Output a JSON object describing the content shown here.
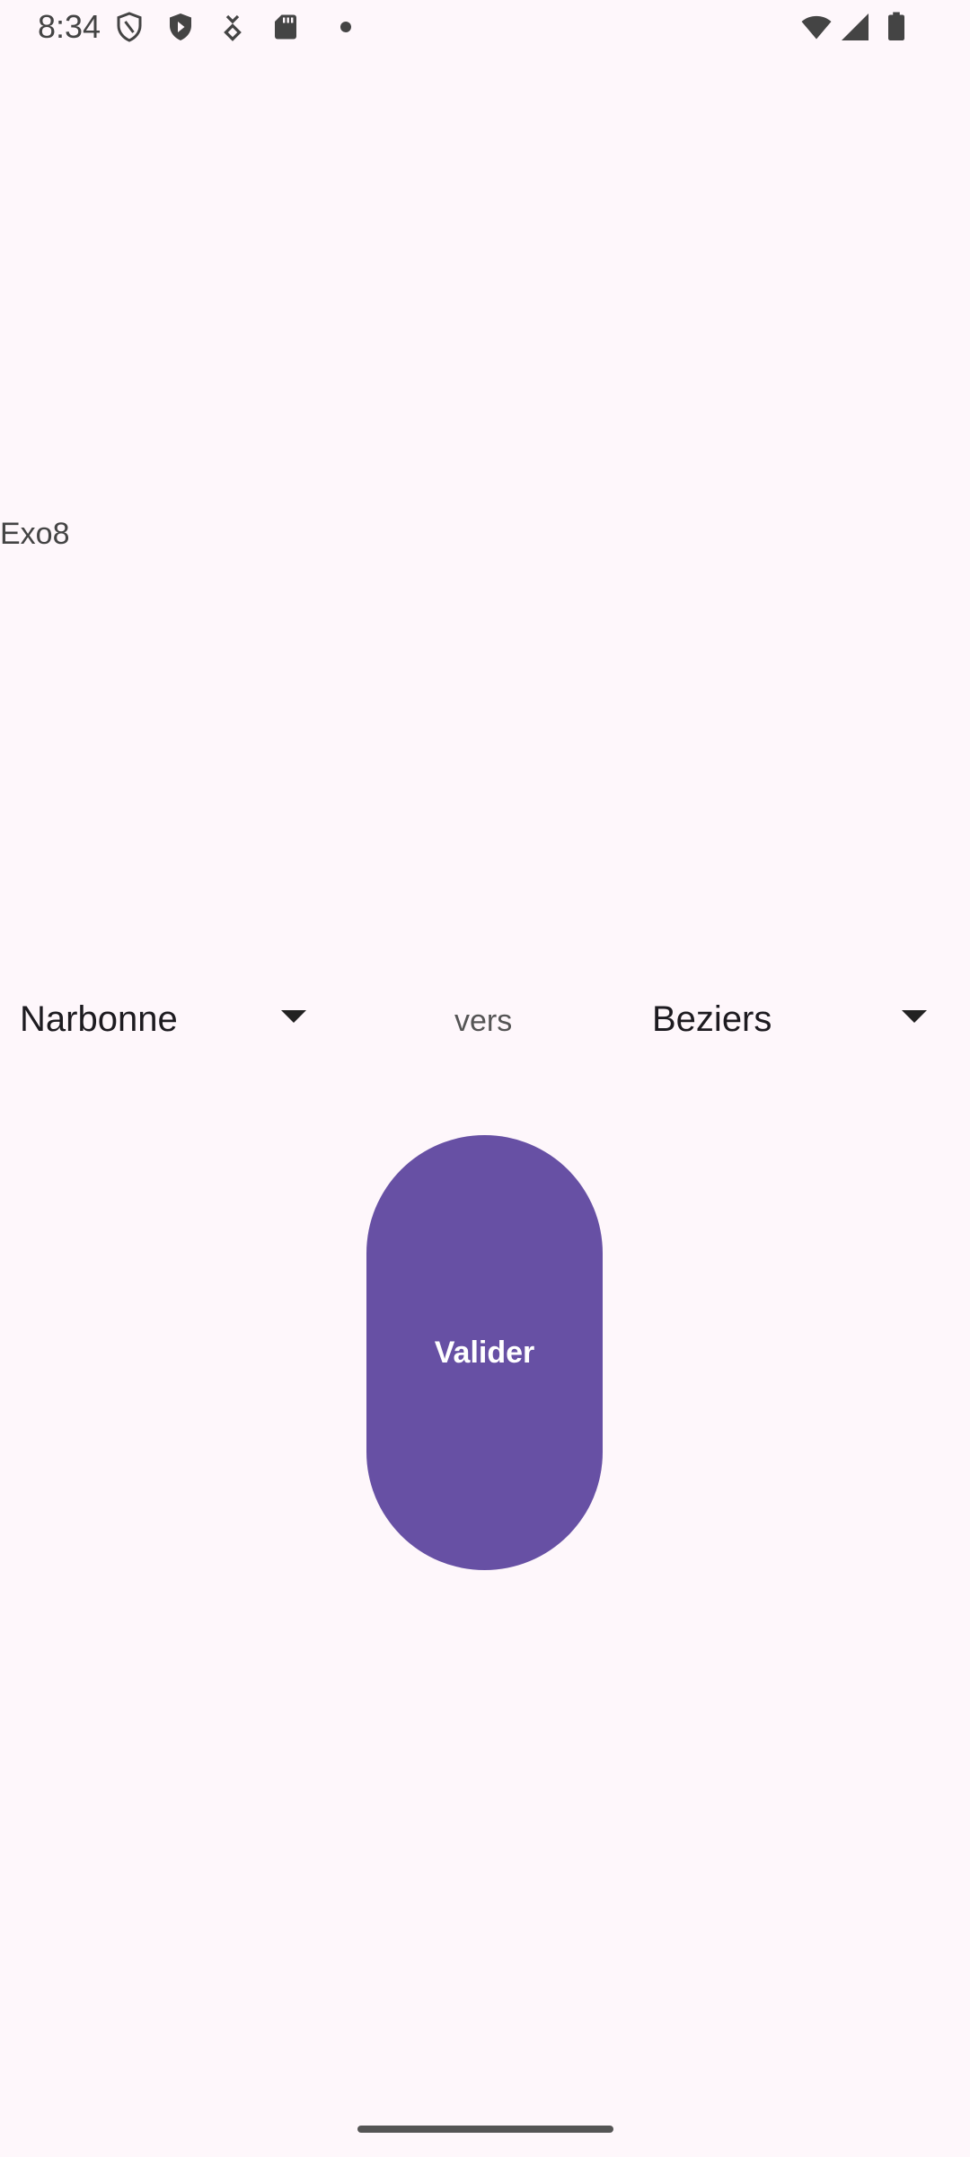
{
  "status_bar": {
    "time": "8:34",
    "left_icons": [
      "shield-outline-icon",
      "play-protect-icon",
      "download-icon",
      "sd-card-icon",
      "dot-icon"
    ],
    "right_icons": [
      "wifi-icon",
      "cellular-signal-icon",
      "battery-icon"
    ]
  },
  "app": {
    "title": "Exo8"
  },
  "route": {
    "from_value": "Narbonne",
    "connector": "vers",
    "to_value": "Beziers"
  },
  "actions": {
    "validate_label": "Valider"
  },
  "colors": {
    "background": "#FEF7FB",
    "primary": "#6750A4",
    "on_primary": "#FFFFFF"
  }
}
